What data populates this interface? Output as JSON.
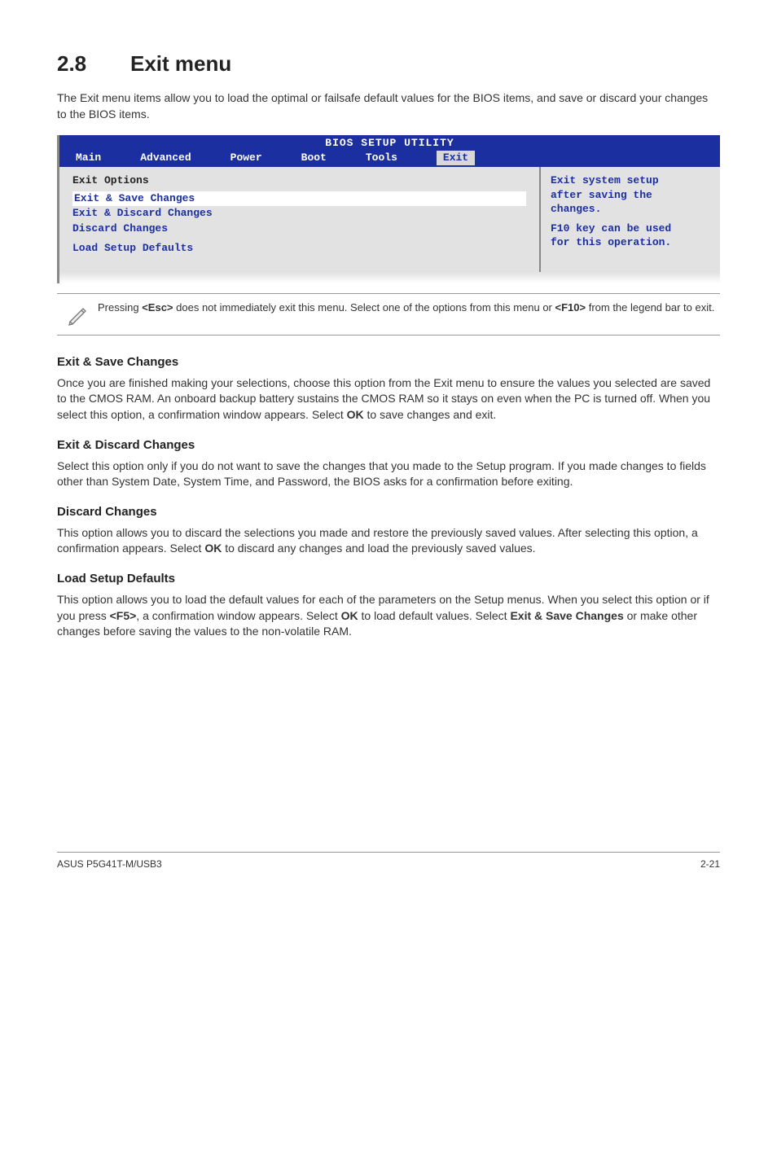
{
  "section": {
    "number": "2.8",
    "title": "Exit menu"
  },
  "intro": "The Exit menu items allow you to load the optimal or failsafe default values for the BIOS items, and save or discard your changes to the BIOS items.",
  "bios": {
    "title": "BIOS SETUP UTILITY",
    "tabs": [
      "Main",
      "Advanced",
      "Power",
      "Boot",
      "Tools",
      "Exit"
    ],
    "active_tab": "Exit",
    "left": {
      "group_label": "Exit Options",
      "items": [
        {
          "label": "Exit & Save Changes",
          "style": "hi"
        },
        {
          "label": "Exit & Discard Changes",
          "style": "blue"
        },
        {
          "label": "Discard Changes",
          "style": "blue"
        },
        {
          "label": "Load Setup Defaults",
          "style": "blue"
        }
      ]
    },
    "help": {
      "line1": "Exit system setup",
      "line2": "after saving the",
      "line3": "changes.",
      "line4": "F10 key can be used",
      "line5": "for this operation."
    }
  },
  "note": {
    "pre": "Pressing ",
    "key1": "<Esc>",
    "mid": " does not immediately exit this menu. Select one of the options from this menu or ",
    "key2": "<F10>",
    "post": " from the legend bar to exit."
  },
  "sections": {
    "s1_h": "Exit & Save Changes",
    "s1_p_a": "Once you are finished making your selections, choose this option from the Exit menu to ensure the values you selected are saved to the CMOS RAM. An onboard backup battery sustains the CMOS RAM so it stays on even when the PC is turned off. When you select this option, a confirmation window appears. Select ",
    "s1_ok": "OK",
    "s1_p_b": " to save changes and exit.",
    "s2_h": "Exit & Discard Changes",
    "s2_p": "Select this option only if you do not want to save the changes that you made to the Setup program. If you made changes to fields other than System Date, System Time, and Password, the BIOS asks for a confirmation before exiting.",
    "s3_h": "Discard Changes",
    "s3_p_a": "This option allows you to discard the selections you made and restore the previously saved values. After selecting this option, a confirmation appears. Select ",
    "s3_ok": "OK",
    "s3_p_b": " to discard any changes and load the previously saved values.",
    "s4_h": "Load Setup Defaults",
    "s4_p_a": "This option allows you to load the default values for each of the parameters on the Setup menus. When you select this option or if you press ",
    "s4_k": "<F5>",
    "s4_p_b": ", a confirmation window appears. Select ",
    "s4_ok": "OK",
    "s4_p_c": " to load default values. Select ",
    "s4_ex": "Exit & Save Changes",
    "s4_p_d": " or make other changes before saving the values to the non-volatile RAM."
  },
  "footer": {
    "left": "ASUS P5G41T-M/USB3",
    "right": "2-21"
  }
}
